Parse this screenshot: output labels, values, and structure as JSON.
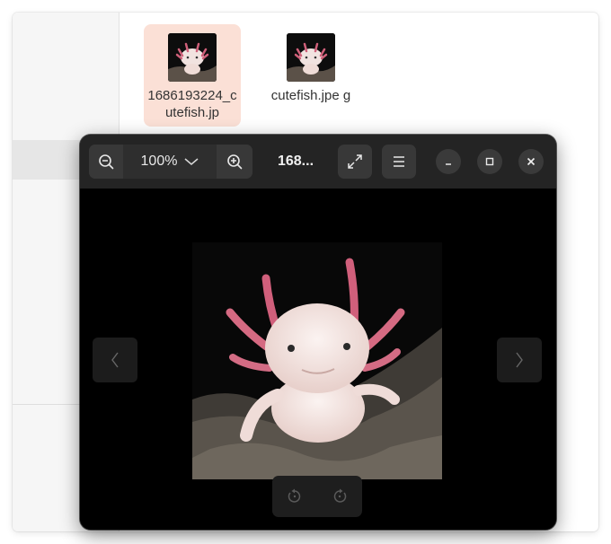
{
  "file_manager": {
    "files": [
      {
        "name": "1686193224_cutefish.jp",
        "selected": true
      },
      {
        "name": "cutefish.jpe g",
        "selected": false
      }
    ]
  },
  "viewer": {
    "zoom_level": "100%",
    "title": "168...",
    "icons": {
      "zoom_out": "zoom-out-icon",
      "zoom_dropdown": "chevron-down-icon",
      "zoom_in": "zoom-in-icon",
      "fullscreen": "fullscreen-icon",
      "menu": "hamburger-menu-icon",
      "minimize": "minimize-icon",
      "maximize": "maximize-icon",
      "close": "close-icon",
      "previous": "chevron-left-icon",
      "next": "chevron-right-icon",
      "rotate_left": "rotate-left-icon",
      "rotate_right": "rotate-right-icon"
    }
  },
  "colors": {
    "selection_highlight": "#fbe0d6",
    "viewer_header": "#242424",
    "viewer_background": "#000000"
  }
}
